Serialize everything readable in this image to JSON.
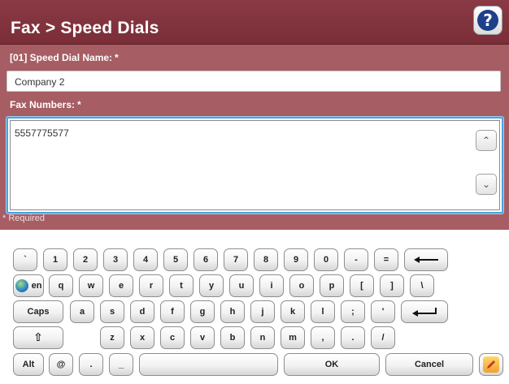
{
  "header": {
    "title": "Fax > Speed Dials",
    "help_icon": "?"
  },
  "form": {
    "name_label": "[01] Speed Dial Name:",
    "name_required_mark": "*",
    "name_value": "Company 2",
    "fax_label": "Fax Numbers:",
    "fax_required_mark": "*",
    "fax_value": "5557775577",
    "required_note": "* Required"
  },
  "keyboard": {
    "row1": [
      "`",
      "1",
      "2",
      "3",
      "4",
      "5",
      "6",
      "7",
      "8",
      "9",
      "0",
      "-",
      "="
    ],
    "backspace_icon": "backspace-arrow-icon",
    "lang": "en",
    "row2": [
      "q",
      "w",
      "e",
      "r",
      "t",
      "y",
      "u",
      "i",
      "o",
      "p",
      "[",
      "]",
      "\\"
    ],
    "caps": "Caps",
    "row3": [
      "a",
      "s",
      "d",
      "f",
      "g",
      "h",
      "j",
      "k",
      "l",
      ";",
      "'"
    ],
    "enter_icon": "enter-arrow-icon",
    "shift_icon": "shift-arrow-icon",
    "row4": [
      "z",
      "x",
      "c",
      "v",
      "b",
      "n",
      "m",
      ",",
      ".",
      "/"
    ],
    "alt": "Alt",
    "at": "@",
    "dot": ".",
    "underscore": "_",
    "ok": "OK",
    "cancel": "Cancel",
    "edit_icon": "pencil-icon"
  }
}
